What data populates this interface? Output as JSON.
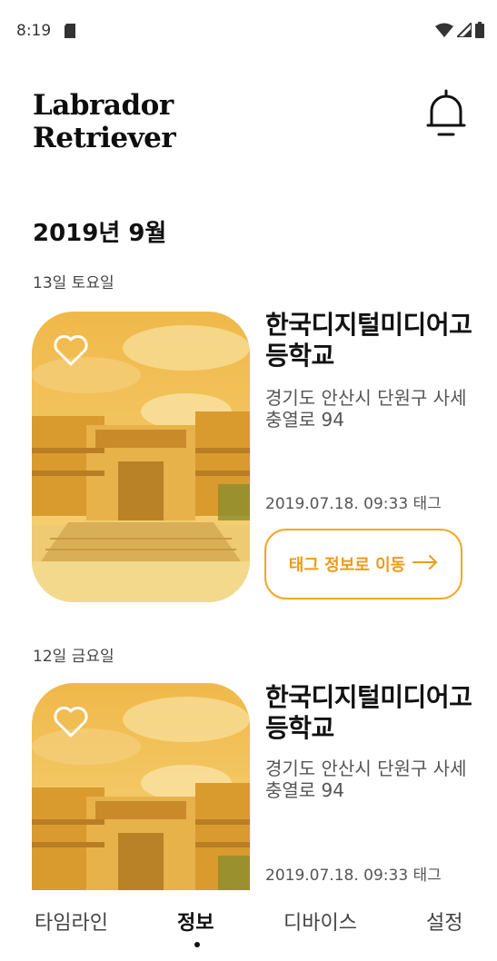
{
  "status": {
    "time": "8:19",
    "icons": [
      "sd-card-icon",
      "wifi-icon",
      "signal-icon",
      "battery-icon"
    ]
  },
  "header": {
    "title": "Labrador\nRetriever",
    "icon": "bell-icon"
  },
  "month": "2019년 9월",
  "entries": [
    {
      "day": "13일 토요일",
      "title": "한국디지털미디어고등학교",
      "address": "경기도 안산시 단원구 사세충열로 94",
      "tagged": "2019.07.18. 09:33 태그",
      "button": "태그 정보로 이동"
    },
    {
      "day": "12일 금요일",
      "title": "한국디지털미디어고등학교",
      "address": "경기도 안산시 단원구 사세충열로 94",
      "tagged": "2019.07.18. 09:33 태그"
    }
  ],
  "nav": {
    "items": [
      "타임라인",
      "정보",
      "디바이스",
      "설정"
    ],
    "active": "정보"
  },
  "colors": {
    "accent": "#f5a623",
    "photo_tint": "#f3c64a"
  }
}
